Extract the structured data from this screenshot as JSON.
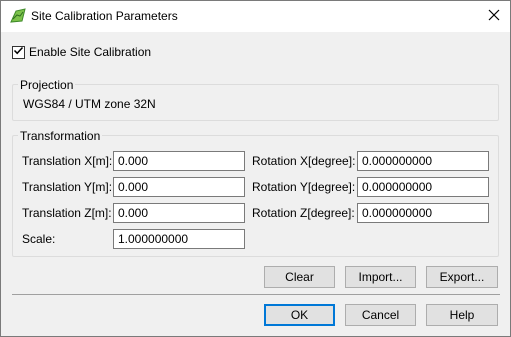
{
  "window": {
    "title": "Site Calibration Parameters"
  },
  "enable": {
    "label": "Enable Site Calibration",
    "checked": true
  },
  "projection": {
    "title": "Projection",
    "value": "WGS84 / UTM zone 32N"
  },
  "transformation": {
    "title": "Transformation",
    "translation_x": {
      "label": "Translation X[m]:",
      "value": "0.000"
    },
    "translation_y": {
      "label": "Translation Y[m]:",
      "value": "0.000"
    },
    "translation_z": {
      "label": "Translation Z[m]:",
      "value": "0.000"
    },
    "scale": {
      "label": "Scale:",
      "value": "1.000000000"
    },
    "rotation_x": {
      "label": "Rotation X[degree]:",
      "value": "0.000000000"
    },
    "rotation_y": {
      "label": "Rotation Y[degree]:",
      "value": "0.000000000"
    },
    "rotation_z": {
      "label": "Rotation Z[degree]:",
      "value": "0.000000000"
    }
  },
  "buttons": {
    "clear": "Clear",
    "import": "Import...",
    "export": "Export...",
    "ok": "OK",
    "cancel": "Cancel",
    "help": "Help"
  },
  "colors": {
    "accent": "#0078d7",
    "app_icon": "#6ab04c"
  }
}
